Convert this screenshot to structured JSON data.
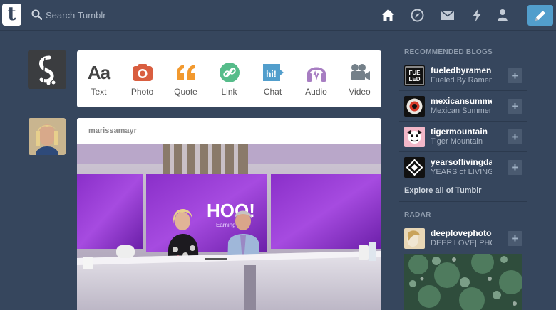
{
  "header": {
    "logo": "t",
    "search_placeholder": "Search Tumblr",
    "icons": [
      "home-icon",
      "explore-icon",
      "inbox-icon",
      "activity-icon",
      "account-icon",
      "compose-icon"
    ]
  },
  "post_types": [
    {
      "label": "Text",
      "glyph": "Aa",
      "color": "#444444"
    },
    {
      "label": "Photo",
      "color": "#d95e40"
    },
    {
      "label": "Quote",
      "glyph": "❝",
      "color": "#f2992e"
    },
    {
      "label": "Link",
      "color": "#56bc8a"
    },
    {
      "label": "Chat",
      "glyph": "hi!",
      "color": "#529ecc"
    },
    {
      "label": "Audio",
      "color": "#a77dc2"
    },
    {
      "label": "Video",
      "color": "#748089"
    }
  ],
  "post": {
    "author": "marissamayr",
    "photo_sign_text": "HOO!",
    "photo_sign_sub": "Earning"
  },
  "sidebar": {
    "recommended_heading": "RECOMMENDED BLOGS",
    "blogs": [
      {
        "name": "fueledbyramen",
        "title": "Fueled By Ramen",
        "avatar_text": "FUE LED"
      },
      {
        "name": "mexicansummer",
        "title": "Mexican Summer"
      },
      {
        "name": "tigermountain",
        "title": "Tiger Mountain"
      },
      {
        "name": "yearsoflivingdange",
        "title": "YEARS of LIVING DAN"
      }
    ],
    "explore_link": "Explore all of Tumblr",
    "radar_heading": "RADAR",
    "radar": {
      "name": "deeplovephotograp",
      "title": "DEEP|LOVE| PHOTOG"
    },
    "follow_symbol": "+"
  }
}
